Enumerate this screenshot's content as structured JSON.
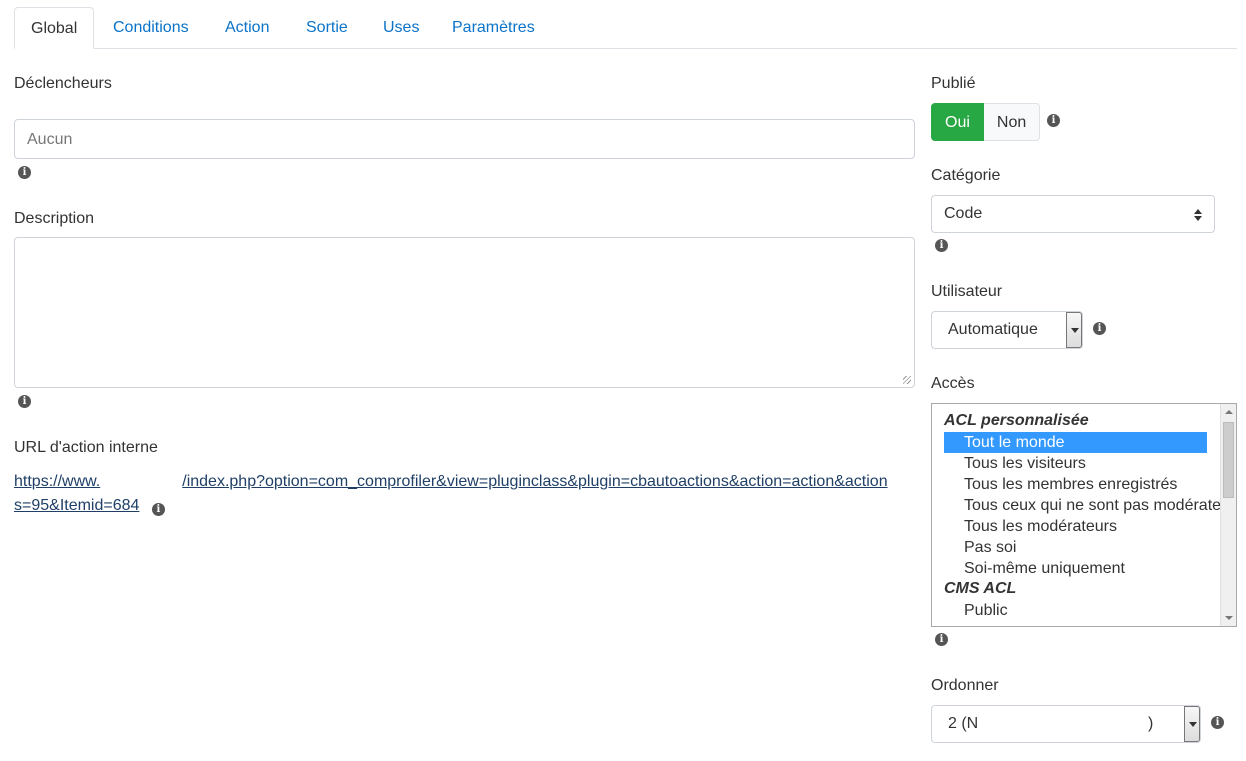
{
  "tabs": [
    "Global",
    "Conditions",
    "Action",
    "Sortie",
    "Uses",
    "Paramètres"
  ],
  "left": {
    "triggers_label": "Déclencheurs",
    "triggers_placeholder": "Aucun",
    "description_label": "Description",
    "url_label": "URL d'action interne",
    "url_line1_start": "https://www.",
    "url_line1_end": "/index.php?option=com_comprofiler&view=pluginclass&plugin=cbautoactions&action=action&action",
    "url_line2": "s=95&Itemid=684"
  },
  "right": {
    "published_label": "Publié",
    "published_yes": "Oui",
    "published_no": "Non",
    "category_label": "Catégorie",
    "category_value": "Code",
    "user_label": "Utilisateur",
    "user_value": "Automatique",
    "access_label": "Accès",
    "access_groups": [
      {
        "name": "ACL personnalisée",
        "items": [
          "Tout le monde",
          "Tous les visiteurs",
          "Tous les membres enregistrés",
          "Tous ceux qui ne sont pas modérateurs",
          "Tous les modérateurs",
          "Pas soi",
          "Soi-même uniquement"
        ]
      },
      {
        "name": "CMS ACL",
        "items": [
          "Public"
        ]
      }
    ],
    "access_selected": "Tout le monde",
    "order_label": "Ordonner",
    "order_value": "2 (N",
    "order_value_end": ")"
  },
  "icons": {
    "info": "info-circle-icon"
  },
  "colors": {
    "accent": "#0b73c8",
    "toggle_on": "#28a745",
    "selection": "#3399ff"
  }
}
